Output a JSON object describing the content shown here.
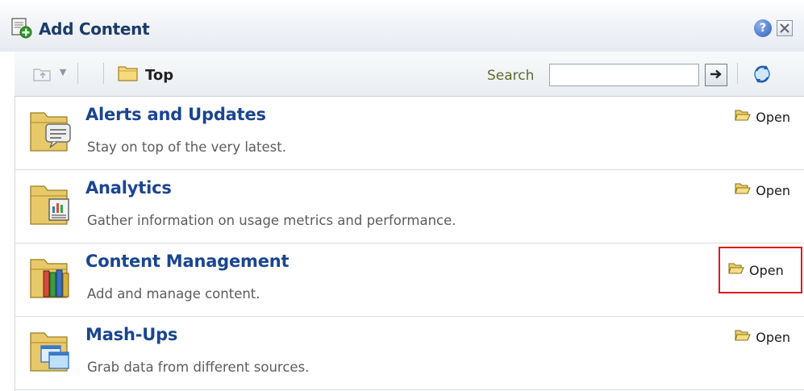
{
  "header": {
    "title": "Add Content",
    "help_icon": "help-icon",
    "close_icon": "close-icon"
  },
  "toolbar": {
    "up_icon": "folder-up-icon",
    "breadcrumb": "Top",
    "search_label": "Search",
    "search_value": "",
    "go_icon": "arrow-right-icon",
    "refresh_icon": "refresh-icon"
  },
  "items": [
    {
      "title": "Alerts and Updates",
      "description": "Stay on top of the very latest.",
      "open_label": "Open",
      "icon": "alerts-folder-icon"
    },
    {
      "title": "Analytics",
      "description": "Gather information on usage metrics and performance.",
      "open_label": "Open",
      "icon": "analytics-folder-icon"
    },
    {
      "title": "Content Management",
      "description": "Add and manage content.",
      "open_label": "Open",
      "icon": "content-management-folder-icon",
      "highlighted": true
    },
    {
      "title": "Mash-Ups",
      "description": "Grab data from different sources.",
      "open_label": "Open",
      "icon": "mashups-folder-icon"
    }
  ],
  "colors": {
    "title": "#1b3b6b",
    "link": "#1a4590",
    "highlight": "#e01b1b",
    "search_label": "#5d6c2a"
  }
}
